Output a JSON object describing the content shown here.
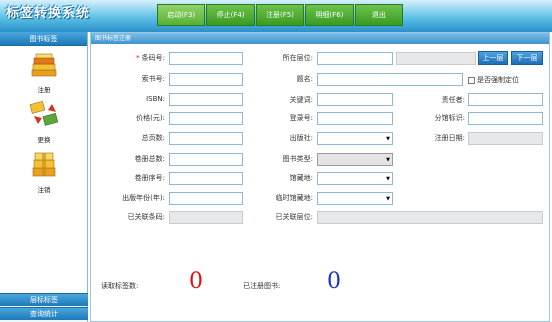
{
  "app": {
    "title": "标签转换系统"
  },
  "toolbar": {
    "start": "启动(F3)",
    "stop": "停止(F4)",
    "register": "注册(F5)",
    "detail": "明细(F6)",
    "exit": "退出"
  },
  "sidebar": {
    "header": "图书标签",
    "items": [
      {
        "label": "注册",
        "icon": "books-stack-icon"
      },
      {
        "label": "更换",
        "icon": "books-exchange-icon"
      },
      {
        "label": "注销",
        "icon": "book-box-icon"
      }
    ],
    "footer_shelf": "层标标签",
    "footer_stats": "查询统计"
  },
  "panel": {
    "title": "图书标签注册",
    "fields": {
      "barcode": {
        "label": "条码号:",
        "value": ""
      },
      "call_no": {
        "label": "索书号:",
        "value": ""
      },
      "isbn": {
        "label": "ISBN:",
        "value": ""
      },
      "price": {
        "label": "价格(元):",
        "value": ""
      },
      "pages": {
        "label": "总页数:",
        "value": ""
      },
      "volumes": {
        "label": "卷册总数:",
        "value": ""
      },
      "volume_no": {
        "label": "卷册序号:",
        "value": ""
      },
      "pub_year": {
        "label": "出版年份(年):",
        "value": ""
      },
      "linked_barcode": {
        "label": "已关联条码:",
        "value": ""
      },
      "shelf": {
        "label": "所在层位:",
        "value": "",
        "code": ""
      },
      "title": {
        "label": "题名:",
        "value": ""
      },
      "keyword": {
        "label": "关键词:",
        "value": ""
      },
      "reg_no": {
        "label": "登录号:",
        "value": ""
      },
      "publisher": {
        "label": "出版社:",
        "value": ""
      },
      "book_type": {
        "label": "图书类型:",
        "value": ""
      },
      "location": {
        "label": "馆藏地:",
        "value": ""
      },
      "temp_location": {
        "label": "临时馆藏地:",
        "value": ""
      },
      "linked_shelf": {
        "label": "已关联层位:",
        "value": ""
      },
      "author": {
        "label": "责任者:",
        "value": ""
      },
      "branch": {
        "label": "分馆标识:",
        "value": ""
      },
      "reg_date": {
        "label": "注册日期:",
        "value": ""
      }
    },
    "prev_button": "上一层",
    "next_button": "下一层",
    "force_position": "是否强制定位",
    "read_label": "读取标签数:",
    "read_count": "0",
    "registered_label": "已注册图书:",
    "registered_count": "0"
  },
  "colors": {
    "read_count": "#e01010",
    "registered_count": "#1a2fd0"
  }
}
